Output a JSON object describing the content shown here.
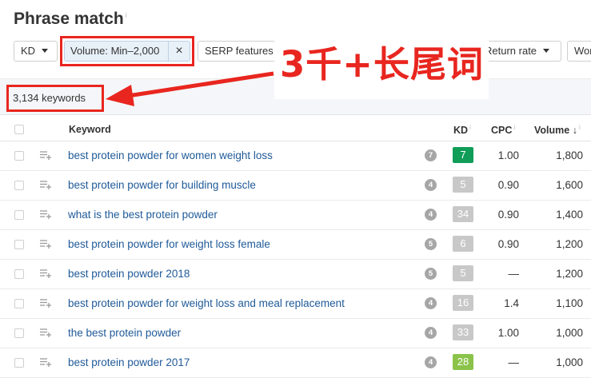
{
  "page": {
    "title": "Phrase match",
    "info_mark": "i"
  },
  "filters": {
    "kd": "KD",
    "volume": "Volume: Min–2,000",
    "volume_clear": "×",
    "serp": "SERP features",
    "return_rate": "Return rate",
    "more": "Wor"
  },
  "results_count": "3,134 keywords",
  "annotation": {
    "text": "3千+长尾词",
    "color": "#e8261f"
  },
  "table": {
    "columns": {
      "keyword": "Keyword",
      "kd": "KD",
      "cpc": "CPC",
      "volume": "Volume ↓",
      "info_mark": "i"
    },
    "rows": [
      {
        "keyword": "best protein powder for women weight loss",
        "serp": "7",
        "kd": "7",
        "kd_color": "#0f9d58",
        "cpc": "1.00",
        "volume": "1,800"
      },
      {
        "keyword": "best protein powder for building muscle",
        "serp": "4",
        "kd": "5",
        "kd_color": "#c8c8c8",
        "cpc": "0.90",
        "volume": "1,600"
      },
      {
        "keyword": "what is the best protein powder",
        "serp": "4",
        "kd": "34",
        "kd_color": "#c8c8c8",
        "cpc": "0.90",
        "volume": "1,400"
      },
      {
        "keyword": "best protein powder for weight loss female",
        "serp": "5",
        "kd": "6",
        "kd_color": "#c8c8c8",
        "cpc": "0.90",
        "volume": "1,200"
      },
      {
        "keyword": "best protein powder 2018",
        "serp": "5",
        "kd": "5",
        "kd_color": "#c8c8c8",
        "cpc": "—",
        "volume": "1,200"
      },
      {
        "keyword": "best protein powder for weight loss and meal replacement",
        "serp": "4",
        "kd": "16",
        "kd_color": "#c8c8c8",
        "cpc": "1.4",
        "volume": "1,100"
      },
      {
        "keyword": "the best protein powder",
        "serp": "4",
        "kd": "33",
        "kd_color": "#c8c8c8",
        "cpc": "1.00",
        "volume": "1,000"
      },
      {
        "keyword": "best protein powder 2017",
        "serp": "4",
        "kd": "28",
        "kd_color": "#8bc34a",
        "cpc": "—",
        "volume": "1,000"
      }
    ]
  }
}
